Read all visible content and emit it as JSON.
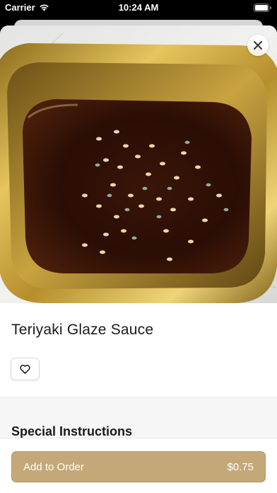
{
  "status_bar": {
    "carrier": "Carrier",
    "time": "10:24 AM"
  },
  "item": {
    "title": "Teriyaki Glaze Sauce",
    "image_icon": "photo-teriyaki-sauce"
  },
  "sections": {
    "special_instructions": "Special Instructions"
  },
  "order": {
    "label": "Add to Order",
    "price": "$0.75"
  },
  "colors": {
    "accent": "#c4a877",
    "sheet_background": "#ffffff"
  }
}
